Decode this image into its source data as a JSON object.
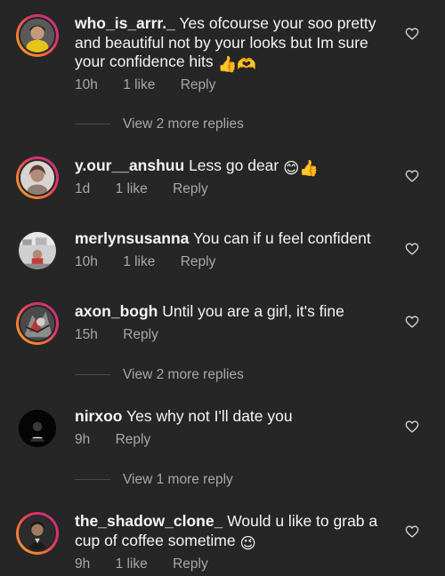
{
  "comments": [
    {
      "username": "who_is_arrr._",
      "text": "Yes ofcourse your soo pretty and beautiful not by your looks but Im sure your confidence hits",
      "emoji": "👍🫶",
      "time": "10h",
      "likes": "1 like",
      "reply": "Reply"
    },
    {
      "username": "y.our__anshuu",
      "text": "Less go dear",
      "emoji": "😊👍",
      "time": "1d",
      "likes": "1 like",
      "reply": "Reply"
    },
    {
      "username": "merlynsusanna",
      "text": "You can if u feel confident",
      "time": "10h",
      "likes": "1 like",
      "reply": "Reply"
    },
    {
      "username": "axon_bogh",
      "text": "Until you are a girl, it's fine",
      "time": "15h",
      "reply": "Reply"
    },
    {
      "username": "nirxoo",
      "text": "Yes why not I'll date you",
      "time": "9h",
      "reply": "Reply"
    },
    {
      "username": "the_shadow_clone_",
      "text": "Would u like to grab a cup of coffee sometime",
      "emoji": "😉",
      "time": "9h",
      "likes": "1 like",
      "reply": "Reply"
    }
  ],
  "view_more": {
    "first": "View 2 more replies",
    "second": "View 2 more replies",
    "third": "View 1 more reply"
  },
  "colors": {
    "background": "#262626",
    "text": "#f5f5f5",
    "secondary": "#a8a8a8"
  }
}
